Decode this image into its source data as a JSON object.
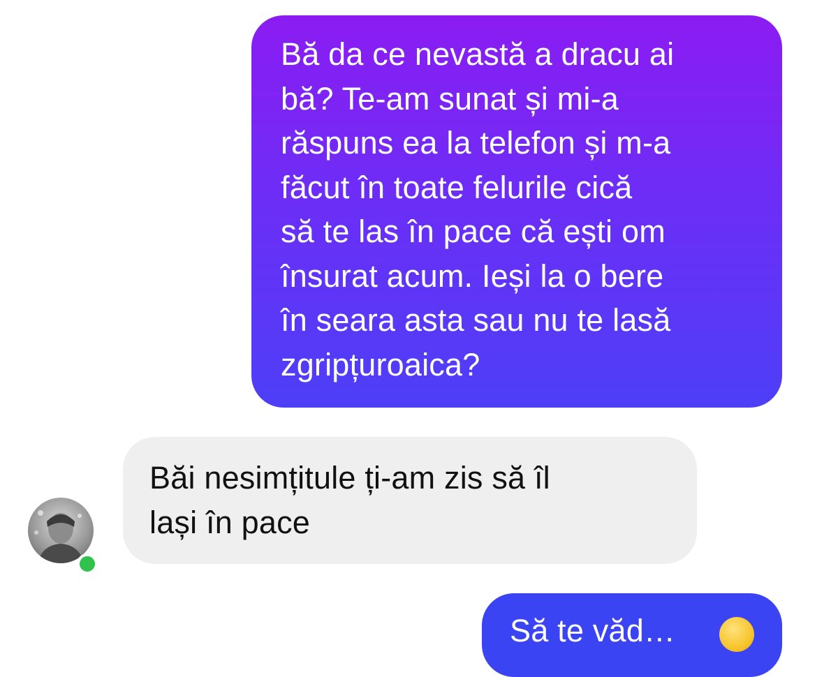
{
  "messages": [
    {
      "sender": "me",
      "lines": [
        "Bă da ce nevastă a dracu ai",
        "bă?  Te-am sunat și mi-a",
        "răspuns ea la telefon și m-a",
        "făcut în toate felurile cică",
        "să te las în pace că ești om",
        "însurat acum. Ieși la o bere",
        "în seara asta sau nu te lasă",
        "zgripțuroaica?"
      ]
    },
    {
      "sender": "contact",
      "lines": [
        "Băi nesimțitule ți-am zis să îl",
        "lași în pace"
      ]
    },
    {
      "sender": "me",
      "lines": [
        "Să te văd…"
      ],
      "emoji": "grinning-face-icon"
    }
  ],
  "contact": {
    "avatar": "contact-avatar",
    "online_indicator": "online-status-dot"
  },
  "colors": {
    "sent_gradient_top": "#8b1cf2",
    "sent_gradient_bottom": "#4d3ff8",
    "sent_solid": "#3b44f2",
    "received_bg": "#efefef",
    "online": "#31c24d"
  }
}
